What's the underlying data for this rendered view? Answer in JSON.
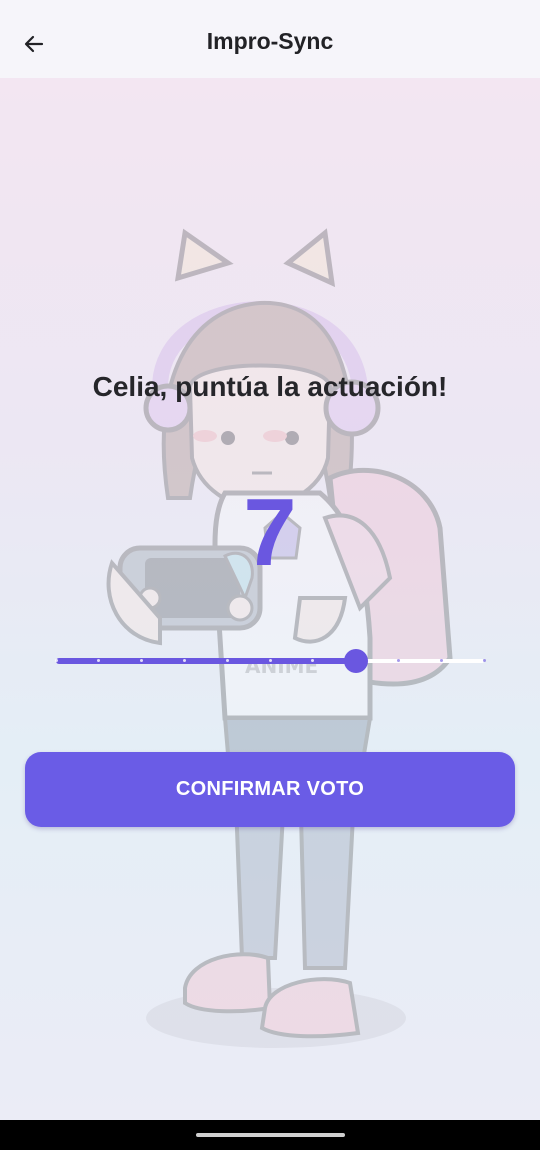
{
  "header": {
    "title": "Impro-Sync",
    "back_icon": "arrow-left-icon"
  },
  "background": {
    "illustration": "girl-with-cat-ear-headphones-illustration",
    "illustration_text": "ANIME"
  },
  "vote": {
    "prompt": "Celia, puntúa la actuación!",
    "score": "7",
    "slider": {
      "min": 0,
      "max": 10,
      "value": 7,
      "steps": 10
    },
    "confirm_label": "CONFIRMAR VOTO"
  },
  "colors": {
    "accent": "#6a57e0",
    "button": "#6a5ce6",
    "text": "#26262a",
    "app_bar": "#f6f5fa",
    "nav_bar": "#000000"
  }
}
